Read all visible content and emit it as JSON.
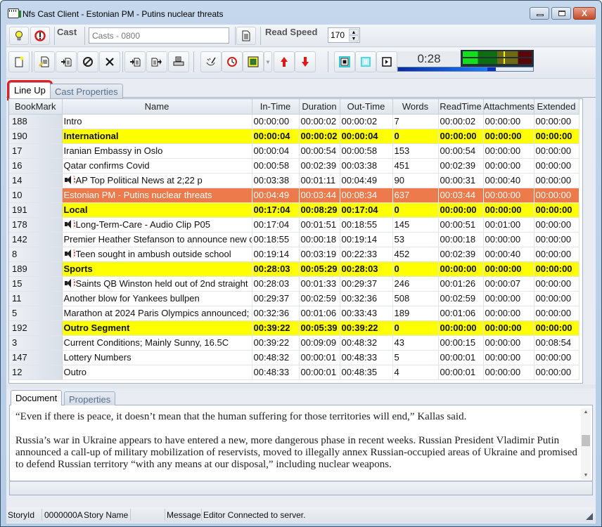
{
  "window": {
    "title": "Nfs Cast Client - Estonian PM - Putins nuclear threats",
    "controls": {
      "minimize": "minimize",
      "maximize": "maximize",
      "close": "X"
    }
  },
  "toolbar1": {
    "cast_label": "Cast",
    "cast_value": "Casts - 0800",
    "read_speed_label": "Read Speed",
    "read_speed_value": "170"
  },
  "toolbar2": {
    "icons": [
      "new-icon",
      "edit-icon",
      "insert-icon",
      "disable-icon",
      "delete-icon",
      "import-icon",
      "export-icon",
      "print-icon",
      "cleanup-icon",
      "timer-icon",
      "grid-icon",
      "dropdown-icon",
      "move-up-icon",
      "move-down-icon"
    ],
    "playback": {
      "stop": "stop",
      "pause": "pause",
      "play": "play"
    },
    "elapsed_time": "0:28",
    "playback_progress": 0.66,
    "vu_level": 0.59
  },
  "tabs_top": [
    {
      "label": "Line Up",
      "active": true
    },
    {
      "label": "Cast Properties",
      "active": false
    }
  ],
  "grid": {
    "columns": [
      "BookMark",
      "Name",
      "In-Time",
      "Duration",
      "Out-Time",
      "Words",
      "ReadTime",
      "Attachments",
      "Extended"
    ],
    "rows": [
      {
        "type": "story",
        "audio": false,
        "cells": [
          "188",
          "Intro",
          "00:00:00",
          "00:00:02",
          "00:00:02",
          "7",
          "00:00:02",
          "00:00:00",
          "00:00:00"
        ]
      },
      {
        "type": "segment",
        "audio": false,
        "cells": [
          "190",
          "International",
          "00:00:04",
          "00:00:02",
          "00:00:04",
          "0",
          "00:00:00",
          "00:00:00",
          "00:00:00"
        ]
      },
      {
        "type": "story",
        "audio": false,
        "cells": [
          "17",
          "Iranian Embassy in Oslo",
          "00:00:04",
          "00:00:54",
          "00:00:58",
          "153",
          "00:00:54",
          "00:00:00",
          "00:00:00"
        ]
      },
      {
        "type": "story",
        "audio": false,
        "cells": [
          "16",
          "Qatar confirms Covid",
          "00:00:58",
          "00:02:39",
          "00:03:38",
          "451",
          "00:02:39",
          "00:00:00",
          "00:00:00"
        ]
      },
      {
        "type": "story",
        "audio": true,
        "cells": [
          "14",
          "AP Top Political News at 2;22 p",
          "00:03:38",
          "00:01:11",
          "00:04:49",
          "90",
          "00:00:31",
          "00:00:40",
          "00:00:00"
        ]
      },
      {
        "type": "selected",
        "audio": false,
        "cells": [
          "10",
          "Estonian PM - Putins nuclear threats",
          "00:04:49",
          "00:03:44",
          "00:08:34",
          "637",
          "00:03:44",
          "00:00:00",
          "00:00:00"
        ]
      },
      {
        "type": "segment",
        "audio": false,
        "cells": [
          "191",
          "Local",
          "00:17:04",
          "00:08:29",
          "00:17:04",
          "0",
          "00:00:00",
          "00:00:00",
          "00:00:00"
        ]
      },
      {
        "type": "story",
        "audio": true,
        "cells": [
          "178",
          "Long-Term-Care - Audio Clip P05",
          "00:17:04",
          "00:01:51",
          "00:18:55",
          "145",
          "00:00:51",
          "00:01:00",
          "00:00:00"
        ]
      },
      {
        "type": "story",
        "audio": false,
        "cells": [
          "142",
          "Premier Heather Stefanson to announce new c",
          "00:18:55",
          "00:00:18",
          "00:19:14",
          "53",
          "00:00:18",
          "00:00:00",
          "00:00:00"
        ]
      },
      {
        "type": "story",
        "audio": true,
        "cells": [
          "8",
          "Teen sought in ambush outside school",
          "00:19:14",
          "00:03:19",
          "00:22:33",
          "452",
          "00:02:39",
          "00:00:40",
          "00:00:00"
        ]
      },
      {
        "type": "segment",
        "audio": false,
        "cells": [
          "189",
          "Sports",
          "00:28:03",
          "00:05:29",
          "00:28:03",
          "0",
          "00:00:00",
          "00:00:00",
          "00:00:00"
        ]
      },
      {
        "type": "story",
        "audio": true,
        "cells": [
          "15",
          "Saints QB Winston held out of 2nd straight",
          "00:28:03",
          "00:01:33",
          "00:29:37",
          "246",
          "00:01:26",
          "00:00:07",
          "00:00:00"
        ]
      },
      {
        "type": "story",
        "audio": false,
        "cells": [
          "11",
          "Another blow for Yankees bullpen",
          "00:29:37",
          "00:02:59",
          "00:32:36",
          "508",
          "00:02:59",
          "00:00:00",
          "00:00:00"
        ]
      },
      {
        "type": "story",
        "audio": false,
        "cells": [
          "5",
          "Marathon at 2024 Paris Olympics announced;",
          "00:32:36",
          "00:01:06",
          "00:33:43",
          "189",
          "00:01:06",
          "00:00:00",
          "00:00:00"
        ]
      },
      {
        "type": "segment",
        "audio": false,
        "cells": [
          "192",
          "Outro Segment",
          "00:39:22",
          "00:05:39",
          "00:39:22",
          "0",
          "00:00:00",
          "00:00:00",
          "00:00:00"
        ]
      },
      {
        "type": "story",
        "audio": false,
        "cells": [
          "3",
          "Current Conditions; Mainly Sunny, 16.5C",
          "00:39:22",
          "00:09:09",
          "00:48:32",
          "43",
          "00:00:15",
          "00:00:00",
          "00:08:54"
        ]
      },
      {
        "type": "story",
        "audio": false,
        "cells": [
          "147",
          "Lottery Numbers",
          "00:48:32",
          "00:00:01",
          "00:48:33",
          "5",
          "00:00:01",
          "00:00:00",
          "00:00:00"
        ]
      },
      {
        "type": "story",
        "audio": false,
        "cells": [
          "12",
          "Outro",
          "00:48:33",
          "00:00:01",
          "00:48:35",
          "4",
          "00:00:01",
          "00:00:00",
          "00:00:00"
        ]
      }
    ]
  },
  "tabs_bottom": [
    {
      "label": "Document",
      "active": true
    },
    {
      "label": "Properties",
      "active": false
    }
  ],
  "document": {
    "paragraphs": [
      "“Even if there is peace, it doesn’t mean that the human suffering for those territories will end,” Kallas said.",
      "Russia’s war in Ukraine appears to have entered a new, more dangerous phase in recent weeks. Russian President Vladimir Putin announced a call-up of military mobilization of reservists, moved to illegally annex Russian-occupied areas of Ukraine and promised to defend Russian territory “with any means at our disposal,” including nuclear weapons."
    ]
  },
  "statusbar": {
    "story_id_label": "StoryId",
    "story_id_value": "0000000A",
    "story_name_label": "Story Name",
    "story_name_value": "",
    "message_label": "Message",
    "message_value": "Editor Connected to server."
  },
  "colors": {
    "segment_row": "#ffff00",
    "selected_row": "#ec7a4a",
    "highlight_outline": "#e21d1d"
  }
}
